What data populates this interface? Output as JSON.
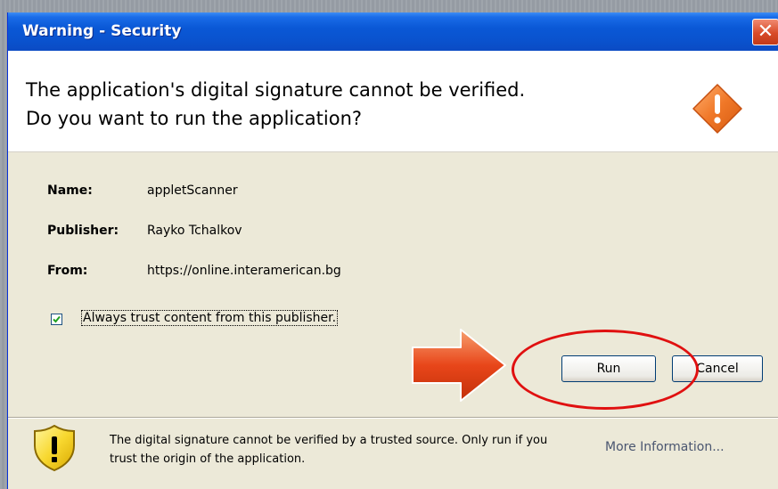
{
  "window": {
    "title": "Warning - Security",
    "close_symbol": "✕"
  },
  "header": {
    "line1": "The application's digital signature cannot be verified.",
    "line2": "Do you want to run the application?",
    "icon": "warning-diamond-icon"
  },
  "details": {
    "name_label": "Name:",
    "name_value": "appletScanner",
    "publisher_label": "Publisher:",
    "publisher_value": "Rayko Tchalkov",
    "from_label": "From:",
    "from_value": "https://online.interamerican.bg"
  },
  "trust_checkbox": {
    "label": "Always trust content from this publisher.",
    "checked": true
  },
  "buttons": {
    "run": "Run",
    "cancel": "Cancel"
  },
  "footer": {
    "message": "The digital signature cannot be verified by a trusted source.  Only run if you trust the origin of the application.",
    "link": "More Information..."
  },
  "colors": {
    "titlebar": "#0a58d6",
    "annotation_red": "#e01010",
    "arrow_orange": "#e8461a"
  }
}
